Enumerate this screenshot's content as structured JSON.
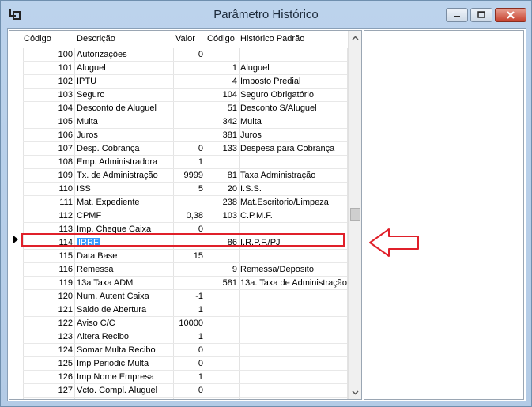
{
  "window": {
    "title": "Parâmetro Histórico",
    "icons": {
      "app": "app-icon",
      "minimize": "minimize-icon",
      "maximize": "maximize-icon",
      "close": "close-icon"
    }
  },
  "grid": {
    "columns": [
      "Código",
      "Descrição",
      "Valor",
      "Código",
      "Histórico Padrão"
    ],
    "rows": [
      {
        "codigo": "100",
        "descricao": "Autorizações",
        "valor": "0",
        "codigo2": "",
        "historico": ""
      },
      {
        "codigo": "101",
        "descricao": "Aluguel",
        "valor": "",
        "codigo2": "1",
        "historico": "Aluguel"
      },
      {
        "codigo": "102",
        "descricao": "IPTU",
        "valor": "",
        "codigo2": "4",
        "historico": "Imposto Predial"
      },
      {
        "codigo": "103",
        "descricao": "Seguro",
        "valor": "",
        "codigo2": "104",
        "historico": "Seguro Obrigatório"
      },
      {
        "codigo": "104",
        "descricao": "Desconto de Aluguel",
        "valor": "",
        "codigo2": "51",
        "historico": "Desconto S/Aluguel"
      },
      {
        "codigo": "105",
        "descricao": "Multa",
        "valor": "",
        "codigo2": "342",
        "historico": "Multa"
      },
      {
        "codigo": "106",
        "descricao": "Juros",
        "valor": "",
        "codigo2": "381",
        "historico": "Juros"
      },
      {
        "codigo": "107",
        "descricao": "Desp. Cobrança",
        "valor": "0",
        "codigo2": "133",
        "historico": "Despesa para Cobrança"
      },
      {
        "codigo": "108",
        "descricao": "Emp. Administradora",
        "valor": "1",
        "codigo2": "",
        "historico": ""
      },
      {
        "codigo": "109",
        "descricao": "Tx. de Administração",
        "valor": "9999",
        "codigo2": "81",
        "historico": "Taxa Administração"
      },
      {
        "codigo": "110",
        "descricao": "ISS",
        "valor": "5",
        "codigo2": "20",
        "historico": "I.S.S."
      },
      {
        "codigo": "111",
        "descricao": "Mat. Expediente",
        "valor": "",
        "codigo2": "238",
        "historico": "Mat.Escritorio/Limpeza"
      },
      {
        "codigo": "112",
        "descricao": "CPMF",
        "valor": "0,38",
        "codigo2": "103",
        "historico": "C.P.M.F."
      },
      {
        "codigo": "113",
        "descricao": "Imp. Cheque Caixa",
        "valor": "0",
        "codigo2": "",
        "historico": ""
      },
      {
        "codigo": "114",
        "descricao": "IRRF",
        "valor": "",
        "codigo2": "86",
        "historico": "I.R.P.F./PJ"
      },
      {
        "codigo": "115",
        "descricao": "Data Base",
        "valor": "15",
        "codigo2": "",
        "historico": ""
      },
      {
        "codigo": "116",
        "descricao": "Remessa",
        "valor": "",
        "codigo2": "9",
        "historico": "Remessa/Deposito"
      },
      {
        "codigo": "119",
        "descricao": "13a Taxa ADM",
        "valor": "",
        "codigo2": "581",
        "historico": "13a. Taxa de Administração"
      },
      {
        "codigo": "120",
        "descricao": "Num. Autent Caixa",
        "valor": "-1",
        "codigo2": "",
        "historico": ""
      },
      {
        "codigo": "121",
        "descricao": "Saldo de Abertura",
        "valor": "1",
        "codigo2": "",
        "historico": ""
      },
      {
        "codigo": "122",
        "descricao": "Aviso C/C",
        "valor": "10000",
        "codigo2": "",
        "historico": ""
      },
      {
        "codigo": "123",
        "descricao": "Altera Recibo",
        "valor": "1",
        "codigo2": "",
        "historico": ""
      },
      {
        "codigo": "124",
        "descricao": "Somar Multa Recibo",
        "valor": "0",
        "codigo2": "",
        "historico": ""
      },
      {
        "codigo": "125",
        "descricao": "Imp Periodic Multa",
        "valor": "0",
        "codigo2": "",
        "historico": ""
      },
      {
        "codigo": "126",
        "descricao": "Imp Nome Empresa",
        "valor": "1",
        "codigo2": "",
        "historico": ""
      },
      {
        "codigo": "127",
        "descricao": "Vcto. Compl. Aluguel",
        "valor": "0",
        "codigo2": "",
        "historico": ""
      }
    ],
    "selected_row": 14,
    "annotation_color": "#e0202a",
    "selection_color": "#3399ff"
  }
}
